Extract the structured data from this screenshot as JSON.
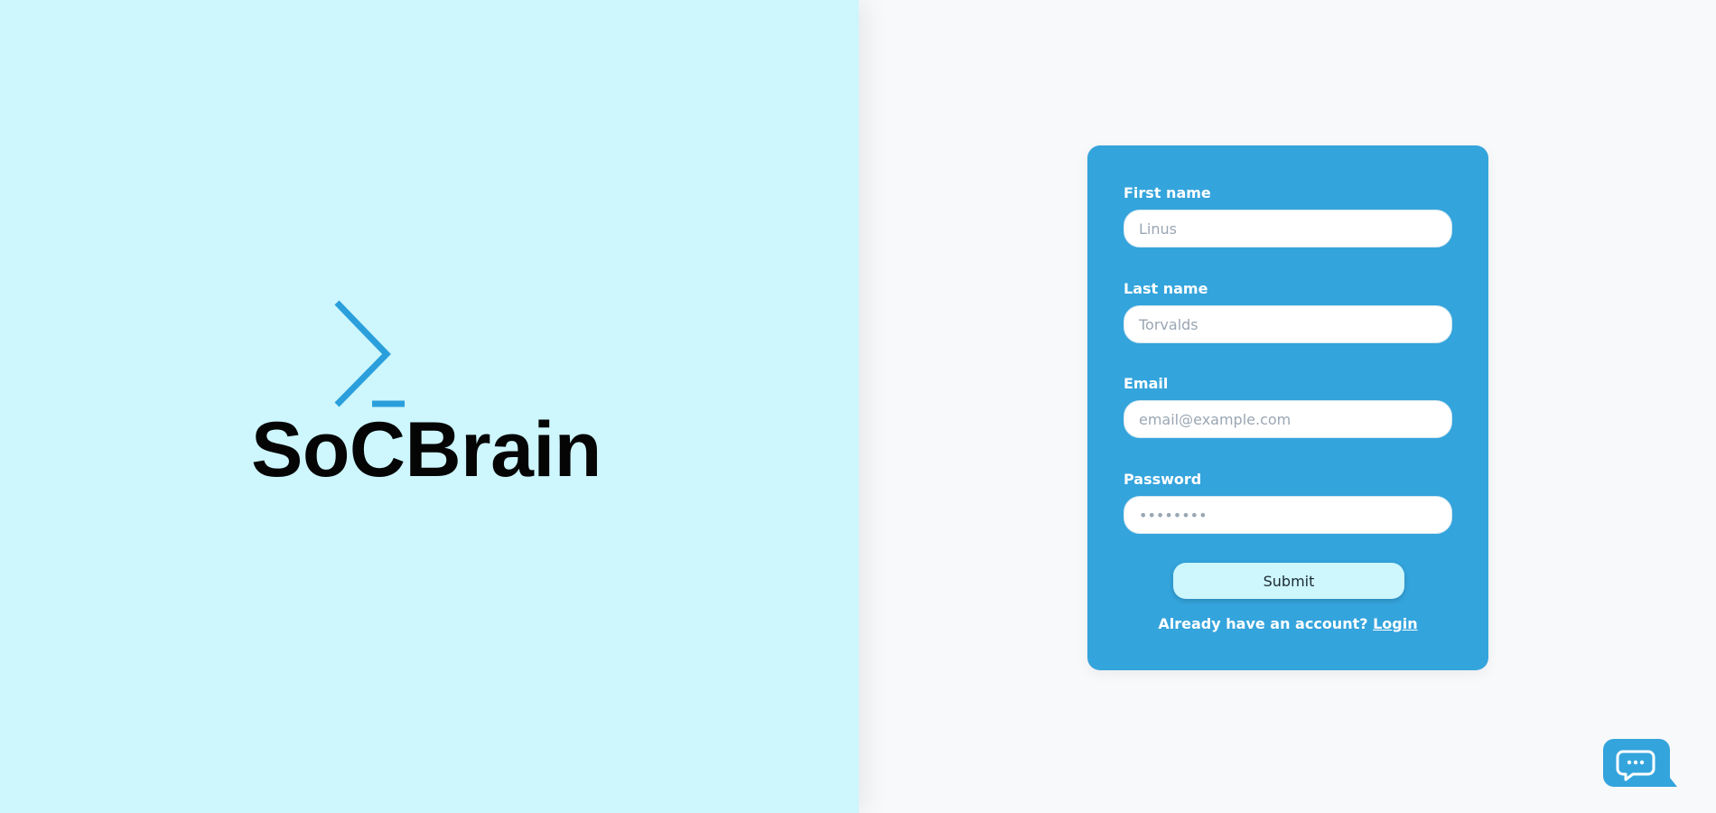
{
  "brand": {
    "name": "SoCBrain",
    "accent": "#34a4dc",
    "left_bg": "#cdf6fd",
    "right_bg": "#f8f9fb"
  },
  "form": {
    "first_name": {
      "label": "First name",
      "placeholder": "Linus",
      "value": ""
    },
    "last_name": {
      "label": "Last name",
      "placeholder": "Torvalds",
      "value": ""
    },
    "email": {
      "label": "Email",
      "placeholder": "email@example.com",
      "value": ""
    },
    "password": {
      "label": "Password",
      "placeholder": "••••••••",
      "value": ""
    },
    "submit_label": "Submit",
    "login_prompt": "Already have an account?",
    "login_link": "Login"
  },
  "chat": {
    "icon": "chat-bubble-icon"
  }
}
